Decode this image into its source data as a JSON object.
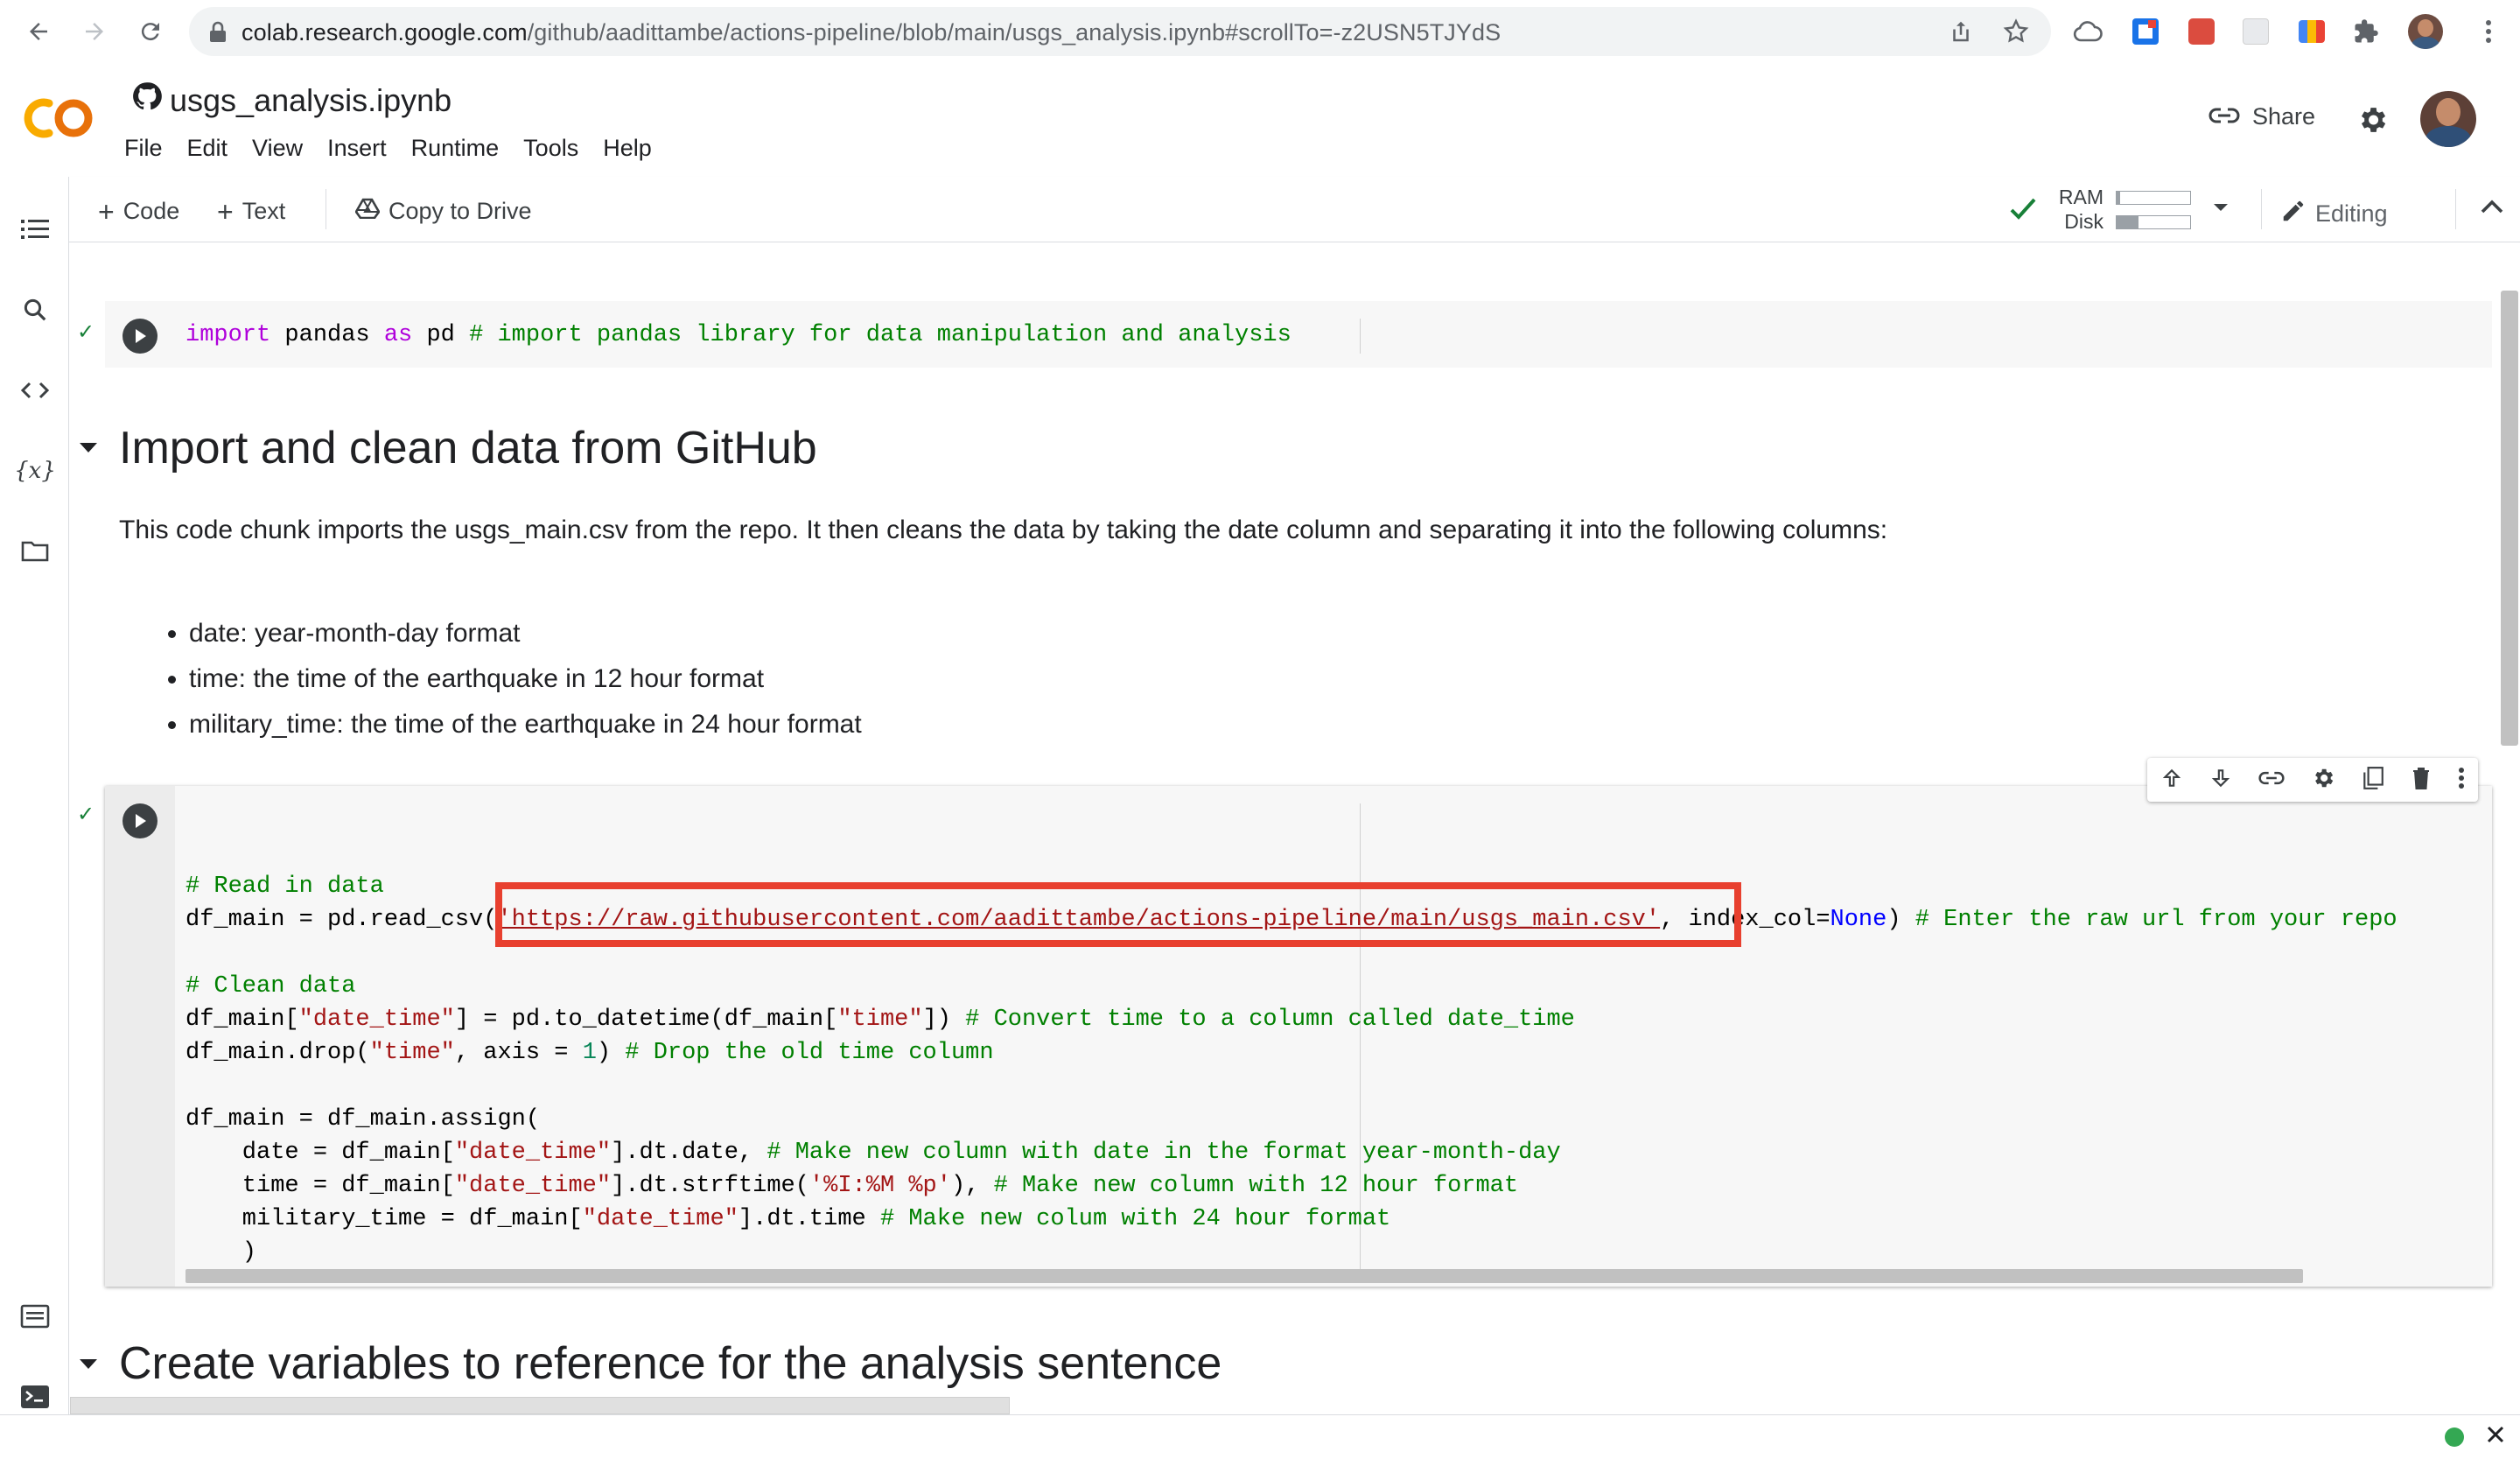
{
  "browser": {
    "url_host": "colab.research.google.com",
    "url_path": "/github/aadittambe/actions-pipeline/blob/main/usgs_analysis.ipynb#scrollTo=-z2USN5TJYdS"
  },
  "header": {
    "logo_text": "CO",
    "notebook_title": "usgs_analysis.ipynb",
    "menu": [
      "File",
      "Edit",
      "View",
      "Insert",
      "Runtime",
      "Tools",
      "Help"
    ],
    "share_label": "Share"
  },
  "toolbar": {
    "add_code_label": "Code",
    "add_text_label": "Text",
    "copy_to_drive_label": "Copy to Drive",
    "ram_label": "RAM",
    "disk_label": "Disk",
    "ram_usage": 0.05,
    "disk_usage": 0.3,
    "editing_label": "Editing"
  },
  "cells": {
    "cell1": {
      "kw_import": "import",
      "t1": " pandas ",
      "kw_as": "as",
      "t2": " pd ",
      "comment": "# import pandas library for data manipulation and analysis"
    },
    "heading1": "Import and clean data from GitHub",
    "paragraph1": "This code chunk imports the usgs_main.csv from the repo. It then cleans the data by taking the date column and separating it into the following columns:",
    "bullets": [
      "date: year-month-day format",
      "time: the time of the earthquake in 12 hour format",
      "military_time: the time of the earthquake in 24 hour format"
    ],
    "cell2": {
      "c_read": "# Read in data",
      "l2_a": "df_main = pd.read_csv(",
      "l2_url": "'https://raw.githubusercontent.com/aadittambe/actions-pipeline/main/usgs_main.csv'",
      "l2_b": ", index_col=",
      "l2_none": "None",
      "l2_c": ") ",
      "l2_cm": "# Enter the raw url from your repo",
      "c_clean": "# Clean data",
      "l4_a": "df_main[",
      "l4_s1": "\"date_time\"",
      "l4_b": "] = pd.to_datetime(df_main[",
      "l4_s2": "\"time\"",
      "l4_c": "]) ",
      "l4_cm": "# Convert time to a column called date_time",
      "l5_a": "df_main.drop(",
      "l5_s": "\"time\"",
      "l5_b": ", axis = ",
      "l5_n": "1",
      "l5_c": ") ",
      "l5_cm": "# Drop the old time column",
      "l7": "df_main = df_main.assign(",
      "l8_a": "    date = df_main[",
      "l8_s": "\"date_time\"",
      "l8_b": "].dt.date, ",
      "l8_cm": "# Make new column with date in the format year-month-day",
      "l9_a": "    time = df_main[",
      "l9_s": "\"date_time\"",
      "l9_b": "].dt.strftime(",
      "l9_s2": "'%I:%M %p'",
      "l9_c": "), ",
      "l9_cm": "# Make new column with 12 hour format",
      "l10_a": "    military_time = df_main[",
      "l10_s": "\"date_time\"",
      "l10_b": "].dt.time ",
      "l10_cm": "# Make new colum with 24 hour format",
      "l11": "    )"
    },
    "heading2": "Create variables to reference for the analysis sentence"
  },
  "colors": {
    "highlight_box": "#e8402f",
    "run_check": "#188038",
    "status_dot": "#34a853"
  }
}
